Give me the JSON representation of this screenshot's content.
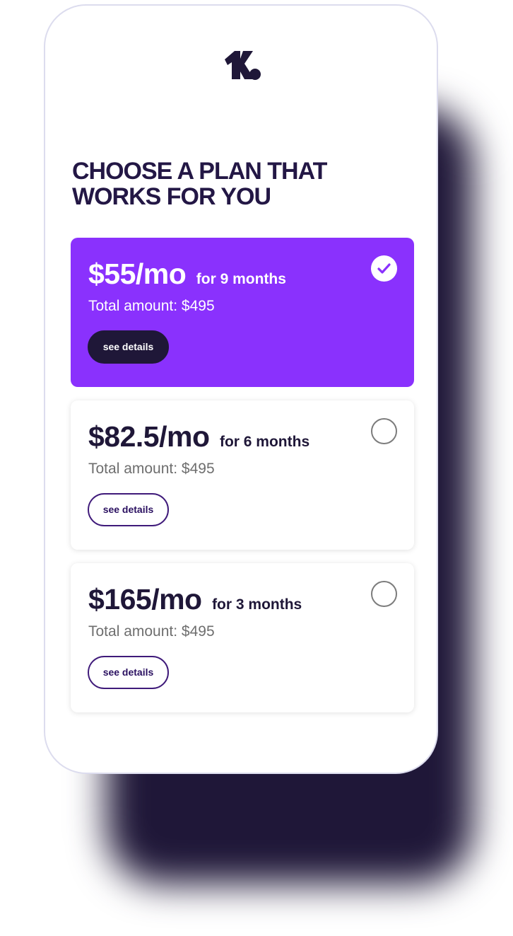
{
  "colors": {
    "accent": "#8a31fd",
    "dark": "#1f1738",
    "muted": "#6e6e6e",
    "background": "#ffffff"
  },
  "header": {
    "logo_icon": "k-logo-icon",
    "title": "CHOOSE A PLAN THAT WORKS FOR YOU"
  },
  "plans": [
    {
      "price": "$55/mo",
      "duration": "for 9 months",
      "total": "Total amount: $495",
      "details_label": "see details",
      "selected": true,
      "radio_icon": "check-circle-icon"
    },
    {
      "price": "$82.5/mo",
      "duration": "for 6 months",
      "total": "Total amount: $495",
      "details_label": "see details",
      "selected": false,
      "radio_icon": "radio-empty-icon"
    },
    {
      "price": "$165/mo",
      "duration": "for 3 months",
      "total": "Total amount: $495",
      "details_label": "see details",
      "selected": false,
      "radio_icon": "radio-empty-icon"
    }
  ]
}
